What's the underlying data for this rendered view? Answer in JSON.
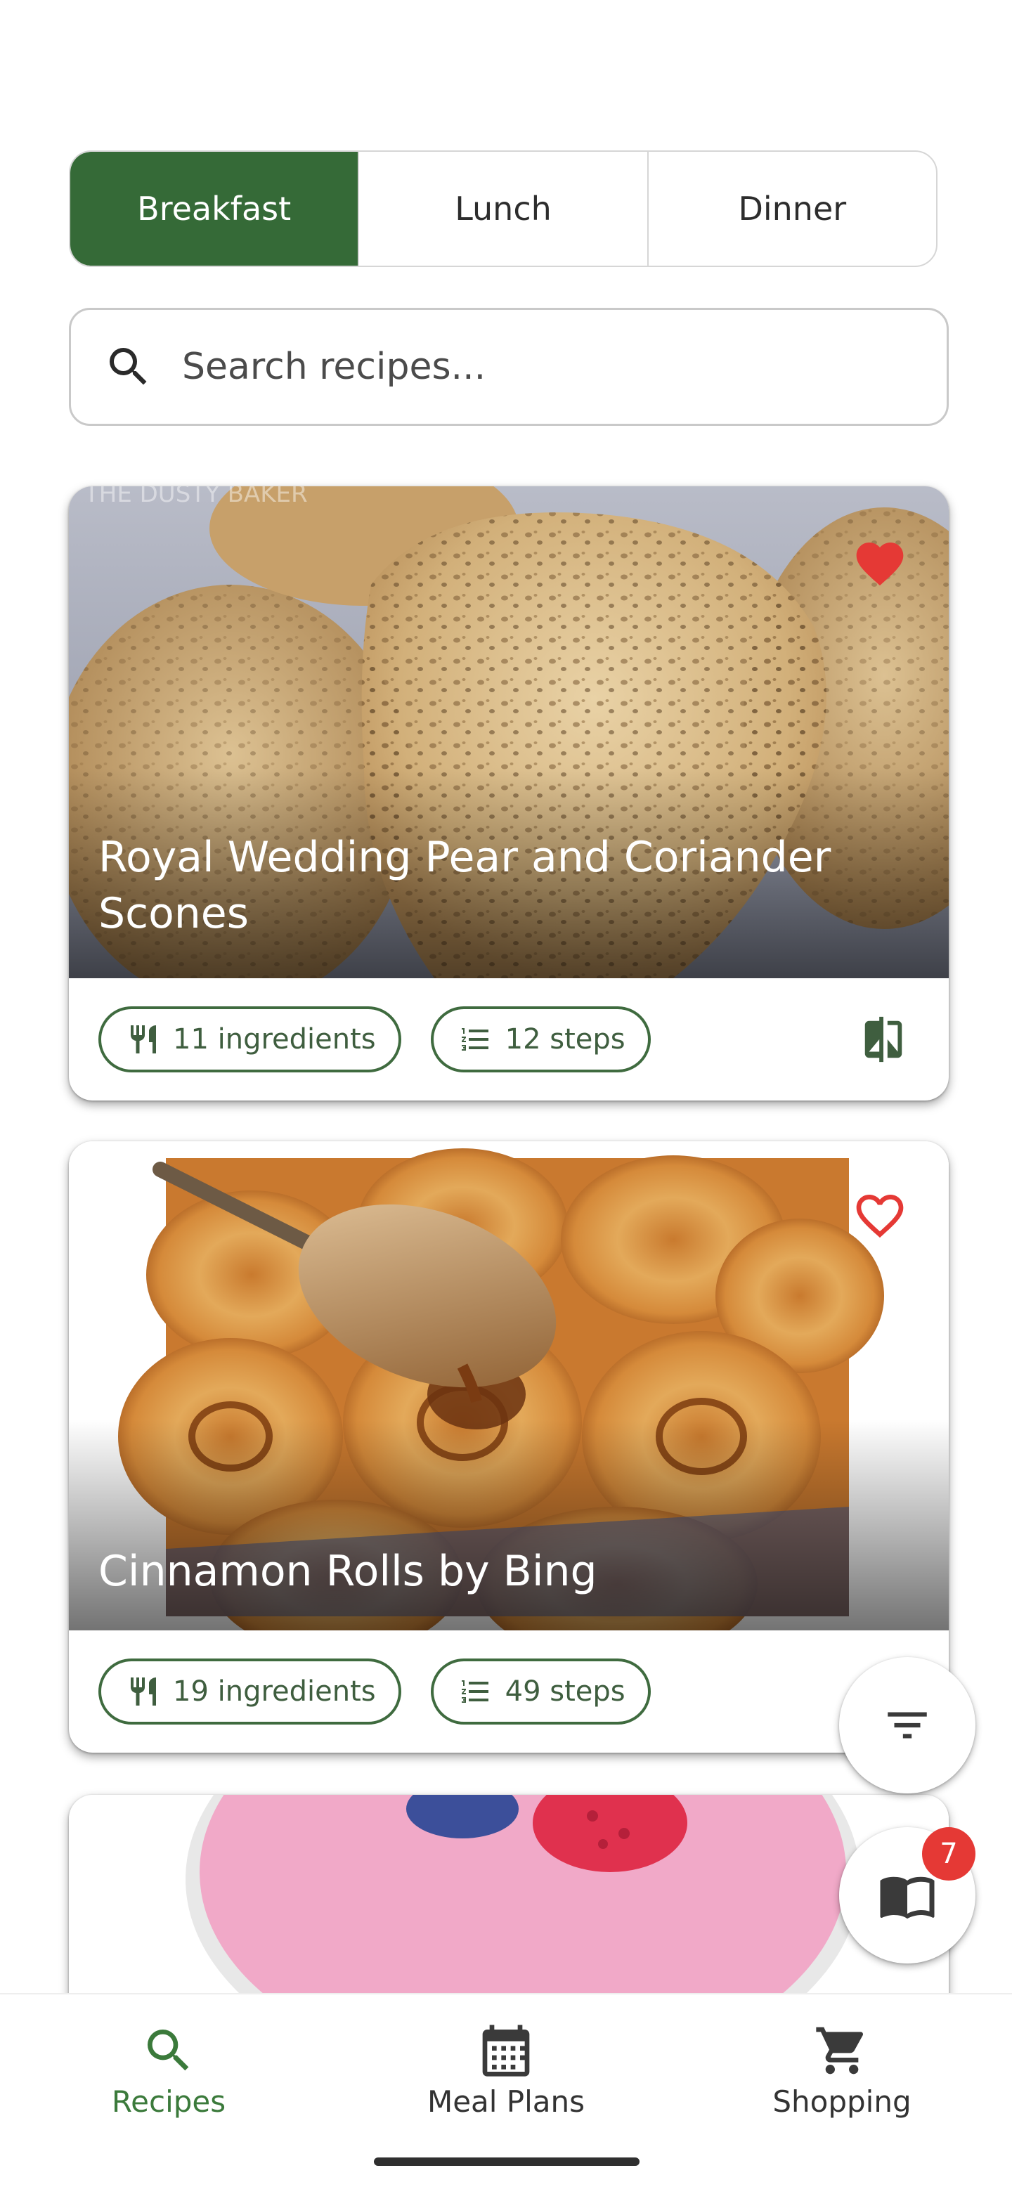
{
  "tabs": [
    {
      "label": "Breakfast",
      "active": true
    },
    {
      "label": "Lunch",
      "active": false
    },
    {
      "label": "Dinner",
      "active": false
    }
  ],
  "search": {
    "placeholder": "Search recipes..."
  },
  "recipes": [
    {
      "title": "Royal Wedding Pear and Coriander Scones",
      "ingredients_label": "11 ingredients",
      "steps_label": "12 steps",
      "favorited": true,
      "image_watermark": "THE DUSTY BAKER"
    },
    {
      "title": "Cinnamon Rolls by Bing",
      "ingredients_label": "19 ingredients",
      "steps_label": "49 steps",
      "favorited": false
    },
    {
      "title": "",
      "image_partial": true
    }
  ],
  "fabs": {
    "filter_icon": "filter-list-icon",
    "meal_book_icon": "book-icon",
    "meal_book_badge": "7"
  },
  "bottom_nav": [
    {
      "label": "Recipes",
      "icon": "search-icon",
      "active": true
    },
    {
      "label": "Meal Plans",
      "icon": "calendar-icon",
      "active": false
    },
    {
      "label": "Shopping",
      "icon": "cart-icon",
      "active": false
    }
  ],
  "colors": {
    "accent": "#356a37",
    "chip_border": "#3f6b3f",
    "heart": "#e53935",
    "nav_active": "#3b7a3b"
  }
}
